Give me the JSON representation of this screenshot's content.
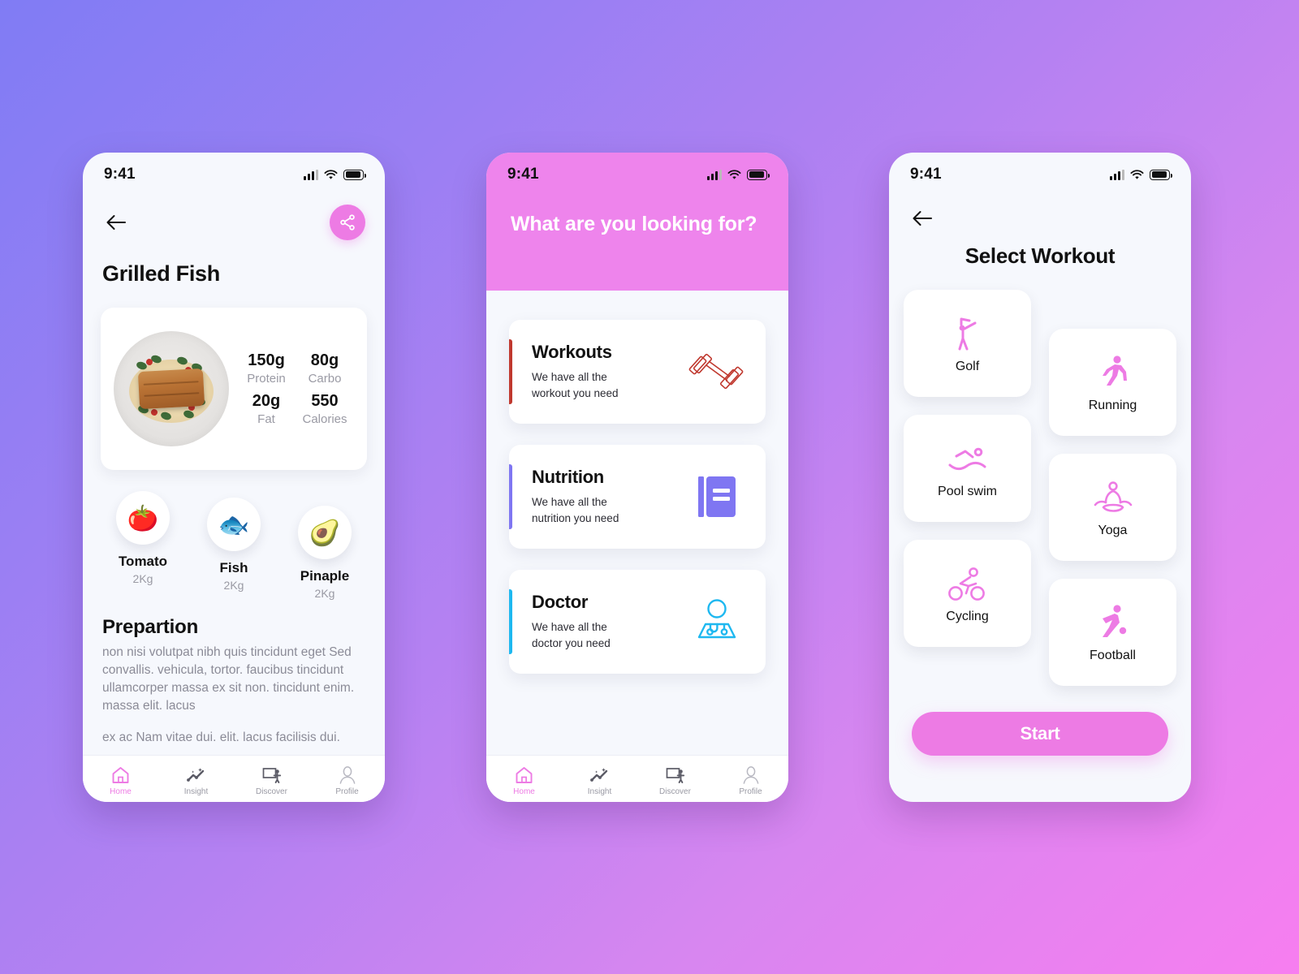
{
  "background": {
    "gradient_from": "#807CF4",
    "gradient_mid": "#B581F2",
    "gradient_to": "#F77EF0"
  },
  "accent": {
    "pink": "#ED7BE4",
    "header_pink": "#EE84EC",
    "workouts_bar": "#C0392F",
    "nutrition_bar": "#7F76F2",
    "doctor_bar": "#1EB8F0"
  },
  "status_bar": {
    "time": "9:41",
    "signal_icon": "cellular-signal-icon",
    "wifi_icon": "wifi-icon",
    "battery_icon": "battery-full-icon"
  },
  "bottom_nav": {
    "items": [
      {
        "label": "Home",
        "icon": "home-icon",
        "active": true
      },
      {
        "label": "Insight",
        "icon": "insight-chart-icon",
        "active": false
      },
      {
        "label": "Discover",
        "icon": "discover-presenter-icon",
        "active": false
      },
      {
        "label": "Profile",
        "icon": "profile-person-icon",
        "active": false
      }
    ]
  },
  "phone1": {
    "back_icon": "back-arrow-icon",
    "share_icon": "share-icon",
    "title": "Grilled Fish",
    "dish_image_alt": "grilled-fish-plate",
    "macros": [
      {
        "value": "150g",
        "label": "Protein"
      },
      {
        "value": "80g",
        "label": "Carbo"
      },
      {
        "value": "20g",
        "label": "Fat"
      },
      {
        "value": "550",
        "label": "Calories"
      }
    ],
    "ingredients": [
      {
        "emoji": "🍅",
        "icon": "tomato-icon",
        "name": "Tomato",
        "qty": "2Kg"
      },
      {
        "emoji": "🐟",
        "icon": "fish-icon",
        "name": "Fish",
        "qty": "2Kg"
      },
      {
        "emoji": "🥑",
        "icon": "avocado-icon",
        "name": "Pinaple",
        "qty": "2Kg"
      }
    ],
    "preparation": {
      "heading": "Prepartion",
      "paragraph1": "non nisi volutpat nibh quis tincidunt eget Sed convallis. vehicula, tortor. faucibus tincidunt ullamcorper massa ex sit non. tincidunt enim. massa elit. lacus",
      "paragraph2": "ex ac Nam vitae dui. elit. lacus facilisis dui."
    }
  },
  "phone2": {
    "question": "What are you looking for?",
    "options": [
      {
        "title": "Workouts",
        "subtitle": "We have all the\nworkout you need",
        "subtitle_line1": "We have all the",
        "subtitle_line2": "workout you need",
        "icon": "dumbbell-icon",
        "color": "#C0392F"
      },
      {
        "title": "Nutrition",
        "subtitle_line1": "We have all the",
        "subtitle_line2": "nutrition you need",
        "icon": "book-icon",
        "color": "#7F76F2"
      },
      {
        "title": "Doctor",
        "subtitle_line1": "We have all the",
        "subtitle_line2": "doctor you need",
        "icon": "doctor-icon",
        "color": "#1EB8F0"
      }
    ]
  },
  "phone3": {
    "back_icon": "back-arrow-icon",
    "title": "Select Workout",
    "workouts_left": [
      {
        "label": "Golf",
        "icon": "golf-icon"
      },
      {
        "label": "Pool swim",
        "icon": "swimming-icon"
      },
      {
        "label": "Cycling",
        "icon": "cycling-icon"
      }
    ],
    "workouts_right": [
      {
        "label": "Running",
        "icon": "running-icon"
      },
      {
        "label": "Yoga",
        "icon": "yoga-icon"
      },
      {
        "label": "Football",
        "icon": "football-icon"
      }
    ],
    "start_label": "Start"
  }
}
